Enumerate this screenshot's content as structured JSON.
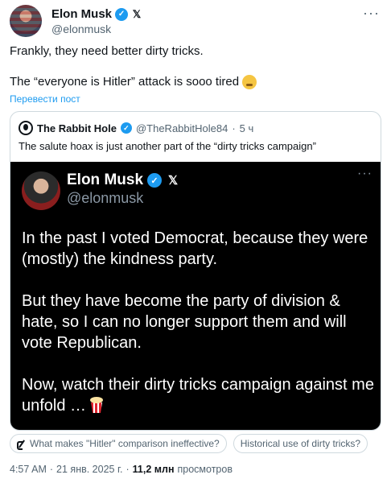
{
  "post": {
    "author_name": "Elon Musk",
    "author_handle": "@elonmusk",
    "verified_icon": "verified-badge-icon",
    "affiliate_icon": "x-logo-icon",
    "more_icon": "more-options-icon",
    "text_line1": "Frankly, they need better dirty tricks.",
    "text_line2": "The “everyone is Hitler” attack is sooo tired",
    "text_line2_emoji": "sleepy-face-emoji",
    "translate_link": "Перевести пост"
  },
  "quote": {
    "author_name": "The Rabbit Hole",
    "author_handle": "@TheRabbitHole84",
    "separator": "·",
    "time_ago": "5 ч",
    "text": "The salute hoax is just another part of the “dirty tricks campaign”",
    "embedded": {
      "author_name": "Elon Musk",
      "author_handle": "@elonmusk",
      "paragraph1": "In the past I voted Democrat, because they were (mostly) the kindness party.",
      "paragraph2": "But they have become the party of division & hate, so I can no longer support them and will vote Republican.",
      "paragraph3": "Now, watch their dirty tricks campaign against me unfold …",
      "paragraph3_emoji": "popcorn-emoji"
    }
  },
  "grok_suggestions": [
    "What makes \"Hitler\" comparison ineffective?",
    "Historical use of dirty tricks?"
  ],
  "meta": {
    "time": "4:57 AM",
    "dot": "·",
    "date": "21 янв. 2025 г.",
    "dot2": "·",
    "views_count": "11,2 млн",
    "views_label": "просмотров"
  },
  "colors": {
    "accent": "#1d9bf0",
    "secondary_text": "#536471",
    "border": "#cfd9de",
    "screenshot_bg": "#000000"
  }
}
